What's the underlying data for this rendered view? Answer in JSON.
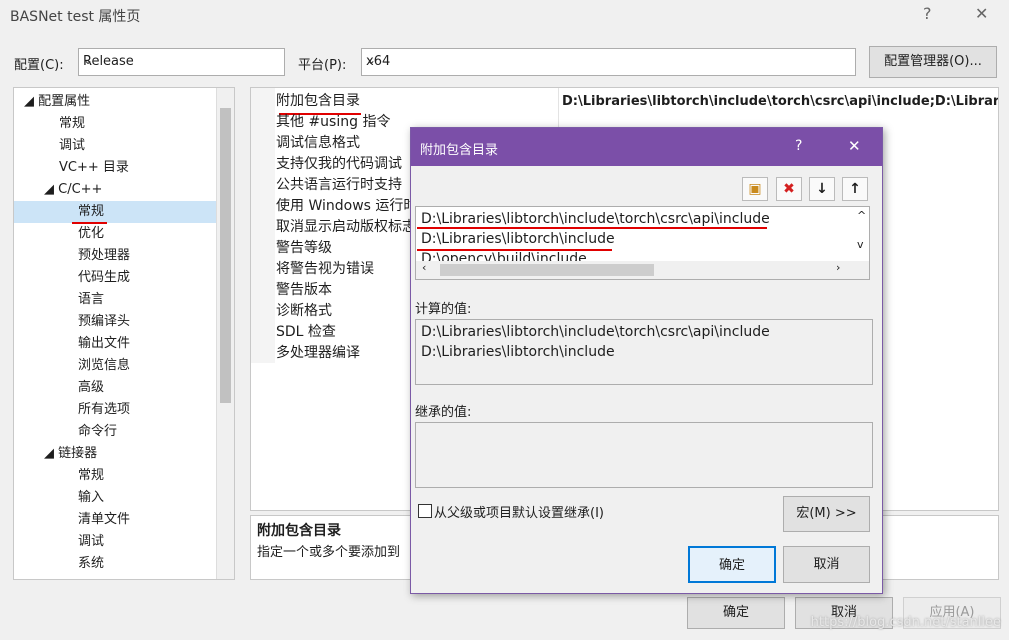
{
  "window": {
    "title": "BASNet test 属性页",
    "help_glyph": "?",
    "close_glyph": "✕"
  },
  "config": {
    "label": "配置(C):",
    "value": "Release"
  },
  "platform": {
    "label": "平台(P):",
    "value": "x64"
  },
  "config_manager_label": "配置管理器(O)...",
  "tree": {
    "items": [
      {
        "label": "◢ 配置属性"
      },
      {
        "label": "常规"
      },
      {
        "label": "调试"
      },
      {
        "label": "VC++ 目录"
      },
      {
        "label": "◢ C/C++"
      },
      {
        "label": "常规"
      },
      {
        "label": "优化"
      },
      {
        "label": "预处理器"
      },
      {
        "label": "代码生成"
      },
      {
        "label": "语言"
      },
      {
        "label": "预编译头"
      },
      {
        "label": "输出文件"
      },
      {
        "label": "浏览信息"
      },
      {
        "label": "高级"
      },
      {
        "label": "所有选项"
      },
      {
        "label": "命令行"
      },
      {
        "label": "◢ 链接器"
      },
      {
        "label": "常规"
      },
      {
        "label": "输入"
      },
      {
        "label": "清单文件"
      },
      {
        "label": "调试"
      },
      {
        "label": "系统"
      }
    ]
  },
  "grid": {
    "rows": [
      "附加包含目录",
      "其他 #using 指令",
      "调试信息格式",
      "支持仅我的代码调试",
      "公共语言运行时支持",
      "使用 Windows 运行时",
      "取消显示启动版权标志",
      "警告等级",
      "将警告视为错误",
      "警告版本",
      "诊断格式",
      "SDL 检查",
      "多处理器编译"
    ],
    "first_value": "D:\\Libraries\\libtorch\\include\\torch\\csrc\\api\\include;D:\\Librarie"
  },
  "description": {
    "title": "附加包含目录",
    "text": "指定一个或多个要添加到"
  },
  "bottom_buttons": {
    "ok": "确定",
    "cancel": "取消",
    "apply": "应用(A)"
  },
  "dialog": {
    "title": "附加包含目录",
    "help_glyph": "?",
    "close_glyph": "✕",
    "toolbar_glyphs": {
      "new_line": "▣",
      "delete": "✖",
      "move_down": "↓",
      "move_up": "↑"
    },
    "entries": [
      "D:\\Libraries\\libtorch\\include\\torch\\csrc\\api\\include",
      "D:\\Libraries\\libtorch\\include",
      "D:\\opencv\\build\\include"
    ],
    "computed_label": "计算的值:",
    "computed": [
      "D:\\Libraries\\libtorch\\include\\torch\\csrc\\api\\include",
      "D:\\Libraries\\libtorch\\include"
    ],
    "inherited_label": "继承的值:",
    "inherit_checkbox_label": "从父级或项目默认设置继承(I)",
    "macro_button": "宏(M) >>",
    "ok": "确定",
    "cancel": "取消"
  },
  "watermark": "https://blog.csdn.net/stanllee",
  "colors": {
    "dialog_title": "#7b4fa8",
    "selection": "#cce4f7",
    "annotation": "#e00000"
  }
}
